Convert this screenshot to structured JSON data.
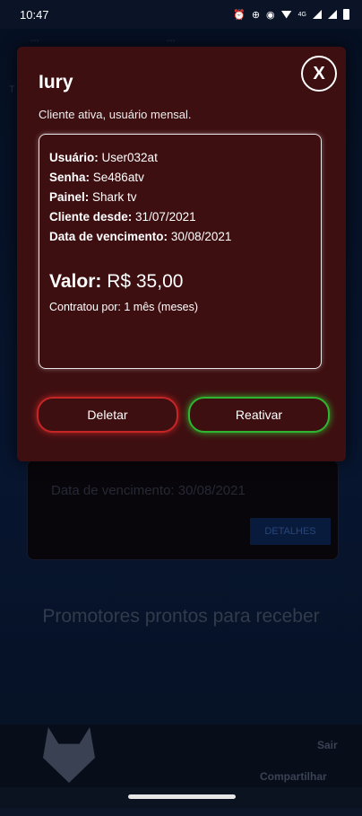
{
  "status_bar": {
    "time": "10:47",
    "network": "4G",
    "icons": [
      "alarm-icon",
      "data-saver-icon",
      "eye-icon",
      "wifi-icon",
      "signal-icon",
      "signal-icon",
      "battery-icon"
    ]
  },
  "background": {
    "card_text": "Data de vencimento: 30/08/2021",
    "details_label": "DETALHES",
    "empty_message": "Promotores prontos para receber",
    "footer": {
      "exit_label": "Sair",
      "share_label": "Compartilhar"
    }
  },
  "dialog": {
    "title": "Iury",
    "subtitle": "Cliente ativa, usuário mensal.",
    "close_label": "X",
    "fields": [
      {
        "label": "Usuário:",
        "value": "User032at"
      },
      {
        "label": "Senha:",
        "value": "Se486atv"
      },
      {
        "label": "Painel:",
        "value": "Shark tv"
      },
      {
        "label": "Cliente desde:",
        "value": "31/07/2021"
      },
      {
        "label": "Data de vencimento:",
        "value": "30/08/2021"
      }
    ],
    "valor_label": "Valor:",
    "valor_value": "R$ 35,00",
    "contract_text": "Contratou por: 1 mês (meses)",
    "delete_label": "Deletar",
    "reactivate_label": "Reativar"
  },
  "colors": {
    "dialog_bg": "#3e0f11",
    "delete_border": "#c42626",
    "reactivate_border": "#2fb52f",
    "app_bg": "#081a33"
  }
}
